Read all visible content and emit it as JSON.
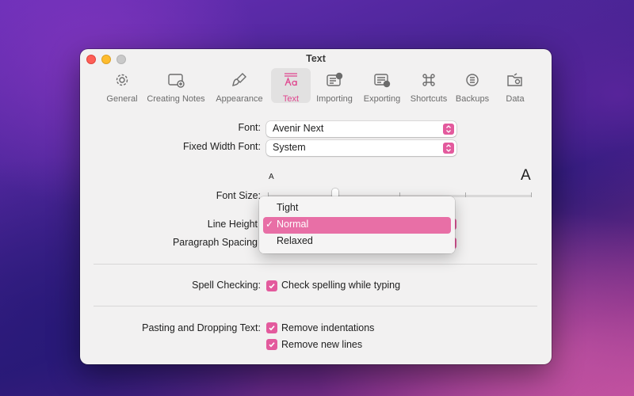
{
  "window": {
    "title": "Text"
  },
  "toolbar": {
    "items": [
      {
        "label": "General",
        "icon": "gear-icon"
      },
      {
        "label": "Creating Notes",
        "icon": "new-note-icon"
      },
      {
        "label": "Appearance",
        "icon": "brush-icon"
      },
      {
        "label": "Text",
        "icon": "text-format-icon",
        "selected": true
      },
      {
        "label": "Importing",
        "icon": "import-icon"
      },
      {
        "label": "Exporting",
        "icon": "export-icon"
      },
      {
        "label": "Shortcuts",
        "icon": "command-icon"
      },
      {
        "label": "Backups",
        "icon": "backup-icon"
      },
      {
        "label": "Data",
        "icon": "folder-icon"
      }
    ]
  },
  "font": {
    "label": "Font:",
    "value": "Avenir Next"
  },
  "fixed_width_font": {
    "label": "Fixed Width Font:",
    "value": "System"
  },
  "font_size": {
    "label": "Font Size:",
    "small_glyph": "A",
    "large_glyph": "A"
  },
  "line_height": {
    "label": "Line Height",
    "selected": "Normal"
  },
  "paragraph_spacing": {
    "label": "Paragraph Spacing"
  },
  "line_height_menu": {
    "options": [
      "Tight",
      "Normal",
      "Relaxed"
    ],
    "checkmark": "✓"
  },
  "spell_checking": {
    "label": "Spell Checking:",
    "option": "Check spelling while typing",
    "checked": true
  },
  "pasting": {
    "label": "Pasting and Dropping Text:",
    "options": [
      {
        "label": "Remove indentations",
        "checked": true
      },
      {
        "label": "Remove new lines",
        "checked": true
      }
    ]
  },
  "colors": {
    "accent": "#e35a9d",
    "highlight": "#e86fa6"
  }
}
